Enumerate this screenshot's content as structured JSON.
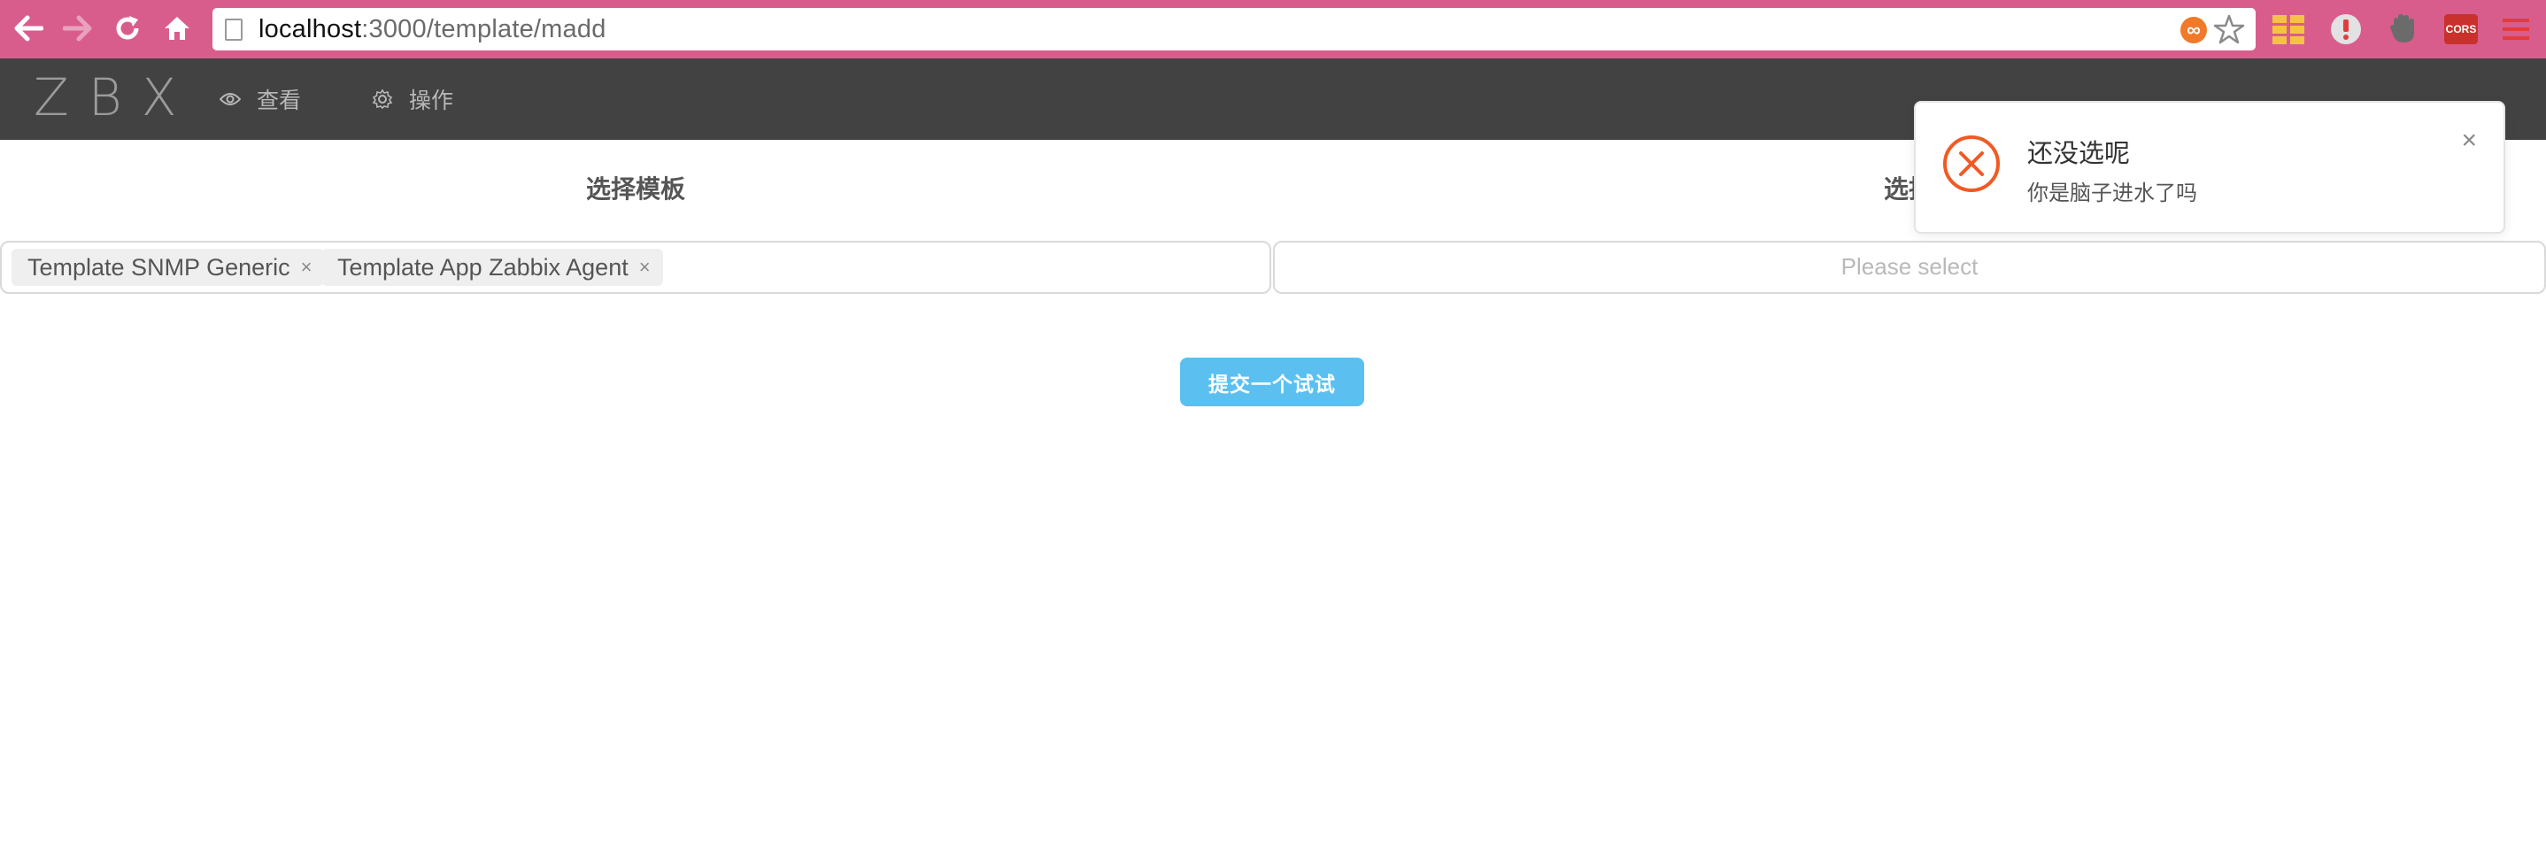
{
  "browser": {
    "url_host": "localhost",
    "url_rest": ":3000/template/madd",
    "extensions": [
      "infinity-icon",
      "star-icon",
      "grid-extension-icon",
      "alert-extension-icon",
      "glove-extension-icon",
      "cors-extension-icon",
      "menu-icon"
    ],
    "cors_label": "CORS",
    "infinity_glyph": "∞"
  },
  "header": {
    "logo": "ZBX",
    "menu": [
      {
        "label": "查看",
        "icon": "eye-icon"
      },
      {
        "label": "操作",
        "icon": "gear-icon"
      }
    ]
  },
  "main": {
    "left_title": "选择模板",
    "right_title": "选择",
    "selected_tags": [
      {
        "label": "Template SNMP Generic",
        "close": "×"
      },
      {
        "label": "Template App Zabbix Agent",
        "close": "×"
      }
    ],
    "right_placeholder": "Please select",
    "submit_label": "提交一个试试"
  },
  "notification": {
    "title": "还没选呢",
    "description": "你是脑子进水了吗",
    "close": "×",
    "type": "error"
  },
  "colors": {
    "browser_bar": "#d95d8c",
    "header_bg": "#424242",
    "primary": "#5bc0f0",
    "error": "#f05a24"
  }
}
